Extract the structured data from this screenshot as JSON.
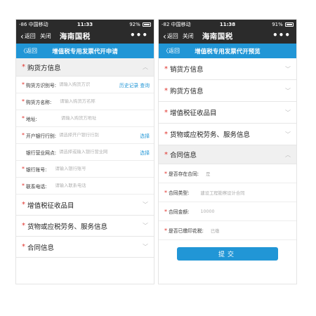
{
  "colors": {
    "wechat_bar": "#2b2b2b",
    "accent": "#2196d6",
    "required": "#e0312b"
  },
  "left": {
    "status": {
      "carrier": "-86 中国移动 ",
      "time": "11:33",
      "battery": "92%"
    },
    "wechat": {
      "back": "返回",
      "close": "关闭",
      "title": "海南国税",
      "more": "•••"
    },
    "header": {
      "back": "返回",
      "title": "增值税专用发票代开申请"
    },
    "section_buyer": {
      "star": "*",
      "label": "购货方信息",
      "icon": "chevron-up-icon"
    },
    "fields": [
      {
        "star": "*",
        "label": "购货方识别号:",
        "placeholder": "请输入购货方识",
        "action": "历史记录  查询"
      },
      {
        "star": "*",
        "label": "购货方名称:",
        "placeholder": "请输入购货方名称",
        "action": ""
      },
      {
        "star": "*",
        "label": "地址:",
        "placeholder": "请输入购货方地址",
        "action": ""
      },
      {
        "star": "*",
        "label": "开户银行行别:",
        "placeholder": "请选择开户银行行别",
        "action": "选择"
      },
      {
        "star": "",
        "label": "银行营业网点:",
        "placeholder": "请选择或输入银行营业网",
        "action": "选择"
      },
      {
        "star": "*",
        "label": "银行账号:",
        "placeholder": "请输入银行账号",
        "action": ""
      },
      {
        "star": "*",
        "label": "联系电话:",
        "placeholder": "请输入联系电话",
        "action": ""
      }
    ],
    "sections_bottom": [
      {
        "star": "*",
        "label": "增值税征收品目"
      },
      {
        "star": "*",
        "label": "货物或应税劳务、服务信息"
      },
      {
        "star": "*",
        "label": "合同信息"
      }
    ]
  },
  "right": {
    "status": {
      "carrier": "-82 中国移动 ",
      "time": "11:38",
      "battery": "91%"
    },
    "wechat": {
      "back": "返回",
      "close": "关闭",
      "title": "海南国税",
      "more": "•••"
    },
    "header": {
      "back": "返回",
      "title": "增值税专用发票代开预览"
    },
    "sections": [
      {
        "star": "*",
        "label": "销货方信息"
      },
      {
        "star": "*",
        "label": "购货方信息"
      },
      {
        "star": "*",
        "label": "增值税征收品目"
      },
      {
        "star": "*",
        "label": "货物或应税劳务、服务信息"
      }
    ],
    "section_contract": {
      "star": "*",
      "label": "合同信息"
    },
    "contract_fields": [
      {
        "star": "*",
        "label": "是否存在合同:",
        "value": "是"
      },
      {
        "star": "*",
        "label": "合同类型:",
        "value": "建设工程勘察设计合同"
      },
      {
        "star": "*",
        "label": "合同金额:",
        "value": "10000"
      },
      {
        "star": "*",
        "label": "是否已缴印花税:",
        "value": "已缴"
      }
    ],
    "submit": "提交"
  }
}
